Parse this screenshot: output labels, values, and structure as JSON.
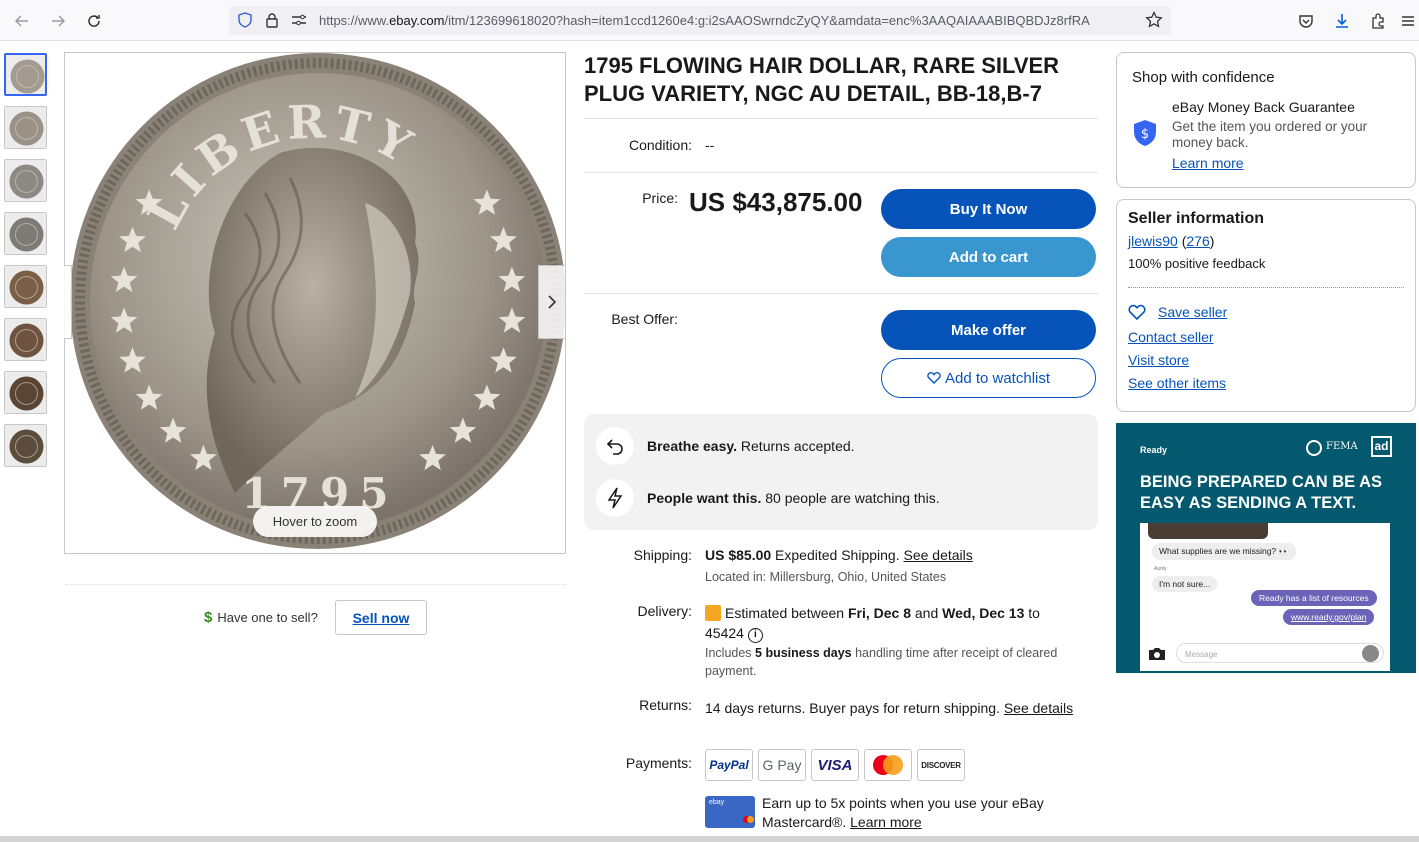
{
  "browser": {
    "url_prefix": "https://www.",
    "url_domain": "ebay.com",
    "url_rest": "/itm/123699618020?hash=item1ccd1260e4:g:i2sAAOSwrndcZyQY&amdata=enc%3AAQAIAAABIBQBDJz8rfRA",
    "icons": [
      "back-icon",
      "forward-icon",
      "reload-icon",
      "shield-icon",
      "lock-icon",
      "permissions-icon",
      "bookmark-star-icon",
      "pocket-icon",
      "downloads-icon",
      "extensions-icon",
      "menu-icon"
    ]
  },
  "gallery": {
    "thumb_count": 8,
    "hover_hint": "Hover to zoom",
    "coin_legend": "LIBERTY",
    "coin_year": "1795"
  },
  "sell": {
    "prompt": "Have one to sell?",
    "button": "Sell now"
  },
  "item": {
    "title": "1795 FLOWING HAIR DOLLAR, RARE SILVER PLUG VARIETY, NGC AU DETAIL, BB-18,B-7",
    "condition_label": "Condition:",
    "condition_value": "--",
    "price_label": "Price:",
    "price_value": "US $43,875.00",
    "buy_now": "Buy It Now",
    "add_to_cart": "Add to cart",
    "best_offer_label": "Best Offer:",
    "make_offer": "Make offer",
    "watchlist": "Add to watchlist"
  },
  "assurance": {
    "returns_bold": "Breathe easy.",
    "returns_text": " Returns accepted.",
    "watch_bold": "People want this.",
    "watch_text": " 80 people are watching this."
  },
  "shipping": {
    "label": "Shipping:",
    "price": "US $85.00",
    "method": " Expedited Shipping. ",
    "details_link": "See details",
    "location": "Located in: Millersburg, Ohio, United States"
  },
  "delivery": {
    "label": "Delivery:",
    "prefix": "Estimated between ",
    "start": "Fri, Dec 8",
    "and": " and ",
    "end": "Wed, Dec 13",
    "suffix": " to",
    "zip": "45424",
    "note_prefix": "Includes ",
    "note_bold": "5 business days",
    "note_suffix": " handling time after receipt of cleared payment."
  },
  "returns": {
    "label": "Returns:",
    "text": "14 days returns. Buyer pays for return shipping. ",
    "link": "See details"
  },
  "payments": {
    "label": "Payments:",
    "methods": [
      "PayPal",
      "G Pay",
      "VISA",
      "Mastercard",
      "DISCOVER"
    ],
    "promo": "Earn up to 5x points when you use your eBay Mastercard®. ",
    "promo_link": "Learn more"
  },
  "confidence": {
    "heading": "Shop with confidence",
    "guarantee_title": "eBay Money Back Guarantee",
    "guarantee_text": "Get the item you ordered or your money back.",
    "learn_more": "Learn more"
  },
  "seller": {
    "heading": "Seller information",
    "name": "jlewis90",
    "feedback_count": "276",
    "feedback_pct": "100% positive feedback",
    "save": "Save seller",
    "contact": "Contact seller",
    "store": "Visit store",
    "other": "See other items"
  },
  "ad": {
    "brand": "Ready",
    "fema": "FEMA",
    "adcouncil": "ad",
    "headline": "BEING PREPARED CAN BE AS EASY AS SENDING A TEXT.",
    "msg1": "What supplies are we missing? 👀",
    "sender": "Aunty",
    "msg2": "I'm not sure...",
    "msg3": "Ready has a list of resources",
    "msg4": "www.ready.gov/plan",
    "input_placeholder": "Message"
  },
  "colors": {
    "primary_blue": "#0654ba",
    "light_blue": "#3a96cf",
    "ad_teal": "#05596f"
  }
}
